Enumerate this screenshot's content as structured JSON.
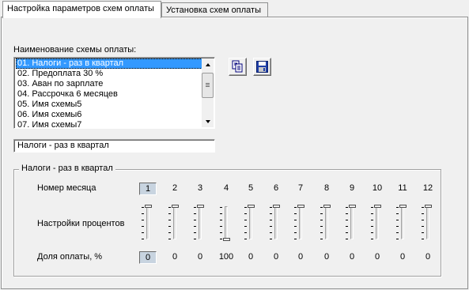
{
  "tabs": [
    {
      "label": "Настройка параметров схем оплаты",
      "active": true
    },
    {
      "label": "Установка схем оплаты",
      "active": false
    }
  ],
  "scheme_list": {
    "label": "Наименование схемы оплаты:",
    "items": [
      "01. Налоги - раз в квартал",
      "02. Предоплата 30 %",
      "03. Аван по зарплате",
      "04. Рассрочка 6 месяцев",
      "05. Имя схемы5",
      "06. Имя схемы6",
      "07. Имя схемы7"
    ],
    "selected_index": 0
  },
  "buttons": {
    "copy_icon": "copy-icon",
    "save_icon": "save-icon"
  },
  "name_field": {
    "value": "Налоги - раз в квартал"
  },
  "group": {
    "title": "Налоги - раз в квартал",
    "month_label": "Номер месяца",
    "percent_label": "Настройки процентов",
    "share_label": "Доля оплаты, %",
    "months": [
      "1",
      "2",
      "3",
      "4",
      "5",
      "6",
      "7",
      "8",
      "9",
      "10",
      "11",
      "12"
    ],
    "shares": [
      "0",
      "0",
      "0",
      "100",
      "0",
      "0",
      "0",
      "0",
      "0",
      "0",
      "0",
      "0"
    ],
    "selected_month_index": 0
  },
  "colors": {
    "selection": "#3399ff",
    "face": "#f0f0f0"
  }
}
